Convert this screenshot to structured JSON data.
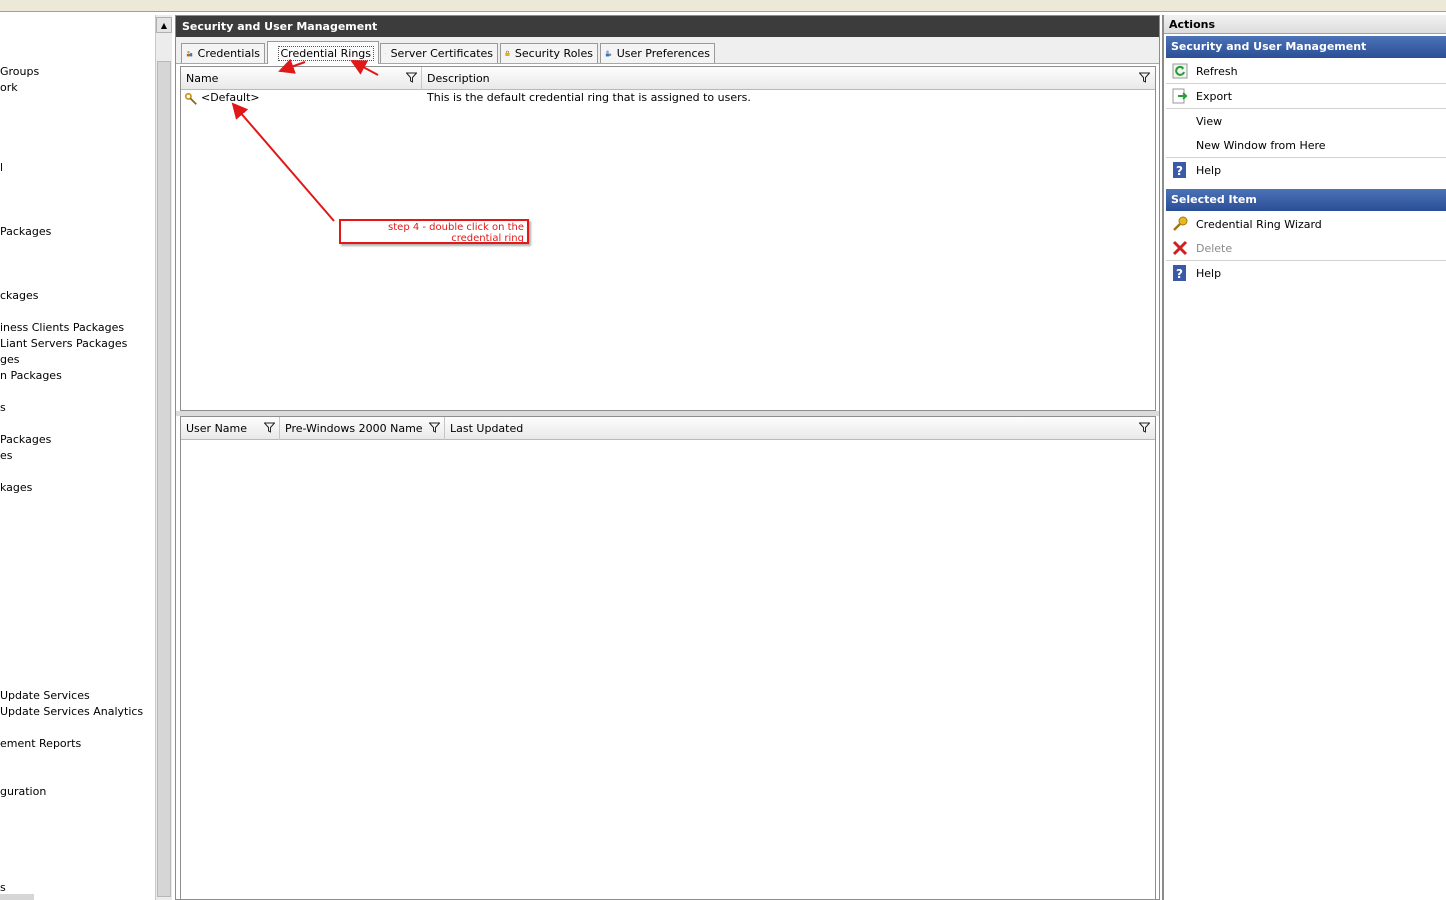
{
  "tree": {
    "items": [
      {
        "label": "Groups"
      },
      {
        "label": "ork"
      },
      {
        "label": "l"
      },
      {
        "label": " Packages"
      },
      {
        "label": "ckages"
      },
      {
        "label": "iness Clients Packages"
      },
      {
        "label": "Liant Servers Packages"
      },
      {
        "label": "ges"
      },
      {
        "label": "n Packages"
      },
      {
        "label": "s"
      },
      {
        "label": "Packages"
      },
      {
        "label": "es"
      },
      {
        "label": "kages"
      },
      {
        "label": "Update Services"
      },
      {
        "label": "Update Services Analytics"
      },
      {
        "label": "ement Reports"
      },
      {
        "label": "guration"
      },
      {
        "label": "s"
      }
    ]
  },
  "center": {
    "title": "Security and User Management",
    "tabs": [
      {
        "label": "Credentials",
        "icon": "credentials-icon"
      },
      {
        "label": "Credential Rings",
        "icon": "credential-rings-icon",
        "active": true
      },
      {
        "label": "Server Certificates",
        "icon": "certificate-icon"
      },
      {
        "label": "Security Roles",
        "icon": "lock-icon"
      },
      {
        "label": "User Preferences",
        "icon": "user-preferences-icon"
      }
    ],
    "top_grid": {
      "columns": [
        "Name",
        "Description"
      ],
      "rows": [
        {
          "name": "<Default>",
          "description": "This is the default credential ring that is assigned to users."
        }
      ]
    },
    "bottom_grid": {
      "columns": [
        "User Name",
        "Pre-Windows 2000 Name",
        "Last Updated"
      ]
    }
  },
  "annotation": {
    "text": "step 4 - double click on the credential ring",
    "color": "#e01818"
  },
  "actions": {
    "title": "Actions",
    "sections": [
      {
        "heading": "Security and User Management",
        "items": [
          {
            "label": "Refresh",
            "icon": "refresh-icon"
          },
          {
            "label": "Export",
            "icon": "export-icon"
          },
          {
            "label": "View",
            "icon": ""
          },
          {
            "label": "New Window from Here",
            "icon": ""
          },
          {
            "label": "Help",
            "icon": "help-icon"
          }
        ]
      },
      {
        "heading": "Selected Item",
        "items": [
          {
            "label": "Credential Ring Wizard",
            "icon": "wizard-key-icon"
          },
          {
            "label": "Delete",
            "icon": "delete-icon",
            "disabled": true
          },
          {
            "label": "Help",
            "icon": "help-icon"
          }
        ]
      }
    ]
  },
  "colors": {
    "title_bar": "#3c3c3c",
    "section_head": "#2b4f96",
    "annotation_red": "#e01818"
  }
}
